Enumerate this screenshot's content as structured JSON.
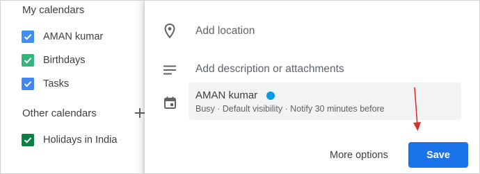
{
  "sidebar": {
    "my_calendars_title": "My calendars",
    "my_calendars": [
      {
        "label": "AMAN kumar",
        "color": "#3f8ef3"
      },
      {
        "label": "Birthdays",
        "color": "#33b679"
      },
      {
        "label": "Tasks",
        "color": "#4285f4"
      }
    ],
    "other_calendars_title": "Other calendars",
    "other_calendars": [
      {
        "label": "Holidays in India",
        "color": "#0b8043"
      }
    ],
    "add_icon": "plus-icon"
  },
  "dialog": {
    "location_placeholder": "Add location",
    "location_icon": "location-pin-icon",
    "description_placeholder": "Add description or attachments",
    "description_icon": "notes-icon",
    "calendar_icon": "calendar-icon",
    "calendar_card": {
      "name": "AMAN kumar",
      "color": "#039be5",
      "details": "Busy · Default visibility · Notify 30 minutes before"
    },
    "more_options_label": "More options",
    "save_label": "Save",
    "save_color": "#1a73e8"
  },
  "annotation": {
    "arrow_color": "#d93025"
  }
}
